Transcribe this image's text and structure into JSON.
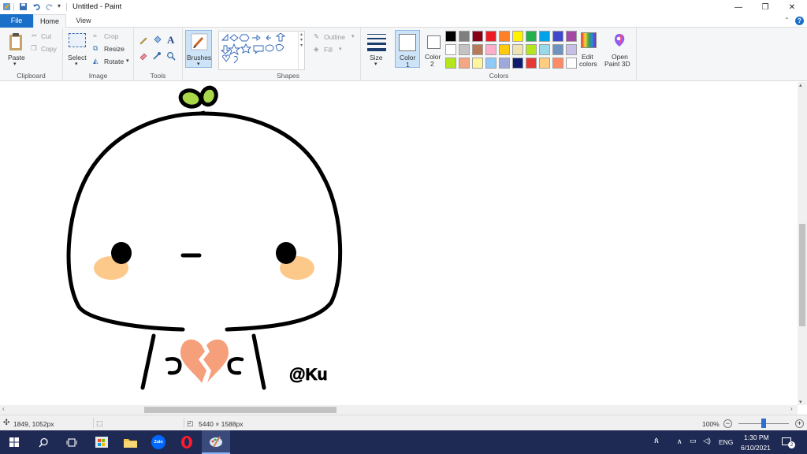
{
  "window": {
    "title": "Untitled - Paint",
    "minimize": "—",
    "restore": "❐",
    "close": "✕",
    "help": "?"
  },
  "tabs": {
    "file": "File",
    "home": "Home",
    "view": "View"
  },
  "clipboard": {
    "paste": "Paste",
    "cut": "Cut",
    "copy": "Copy",
    "label": "Clipboard"
  },
  "image": {
    "select": "Select",
    "crop": "Crop",
    "resize": "Resize",
    "rotate": "Rotate",
    "label": "Image"
  },
  "tools": {
    "label": "Tools",
    "text_tool": "A"
  },
  "brushes": {
    "label": "Brushes"
  },
  "shapes": {
    "outline": "Outline",
    "fill": "Fill",
    "label": "Shapes"
  },
  "size": {
    "label": "Size"
  },
  "color1": {
    "label": "Color",
    "num": "1",
    "value": "#ffffff"
  },
  "color2": {
    "label": "Color",
    "num": "2",
    "value": "#ffffff"
  },
  "colors": {
    "label": "Colors",
    "edit_label1": "Edit",
    "edit_label2": "colors",
    "palette": [
      "#000000",
      "#7f7f7f",
      "#880015",
      "#ed1c24",
      "#ff7f27",
      "#fff200",
      "#22b14c",
      "#00a2e8",
      "#3f48cc",
      "#a349a4",
      "#ffffff",
      "#c3c3c3",
      "#b97a57",
      "#ffaec9",
      "#ffc90e",
      "#efe4b0",
      "#b5e61d",
      "#99d9ea",
      "#7092be",
      "#c8bfe7",
      "#b5e61d",
      "#f4a582",
      "#fff59d",
      "#90caf9",
      "#9fa8da",
      "#0d1b6e",
      "#e53935",
      "#ffcc80",
      "#ff8a65",
      "#ffffff"
    ]
  },
  "paint3d": {
    "label1": "Open",
    "label2": "Paint 3D"
  },
  "drawing": {
    "signature": "@Ku"
  },
  "status": {
    "cursor": "1849, 1052px",
    "size": "5440 × 1588px",
    "zoom": "100%"
  },
  "taskbar": {
    "lang": "ENG",
    "time": "1:30 PM",
    "date": "6/10/2021",
    "notif": "2"
  }
}
